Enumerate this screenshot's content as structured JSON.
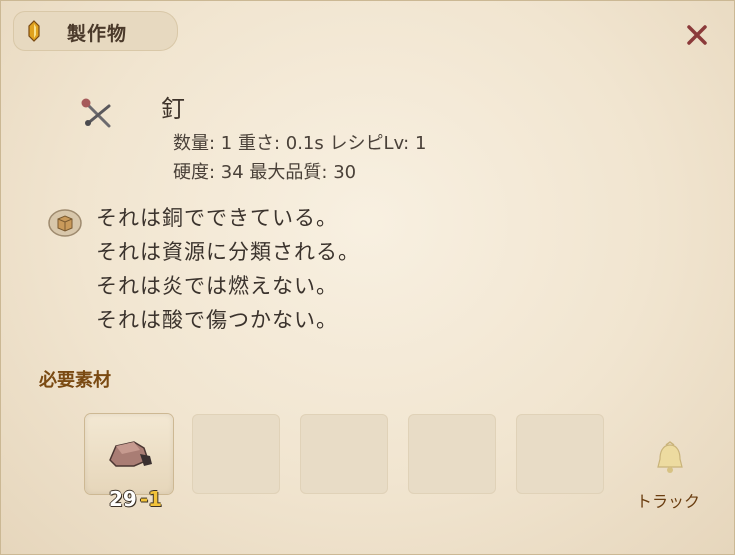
{
  "window": {
    "title": "製作物",
    "close_icon": "close-x-icon",
    "accent_color": "#7a4a12"
  },
  "item": {
    "name": "釘",
    "icon": "nail-icon",
    "stats_line1": [
      {
        "label": "数量",
        "value": "1"
      },
      {
        "label": "重さ",
        "value": "0.1s"
      },
      {
        "label": "レシピLv",
        "value": "1"
      }
    ],
    "stats_line2": [
      {
        "label": "硬度",
        "value": "34"
      },
      {
        "label": "最大品質",
        "value": "30"
      }
    ],
    "stats_text1": "数量: 1  重さ: 0.1s  レシピLv: 1",
    "stats_text2": "硬度: 34  最大品質: 30"
  },
  "description": {
    "icon": "material-box-icon",
    "lines": [
      "それは銅でできている。",
      "それは資源に分類される。",
      "それは炎では燃えない。",
      "それは酸で傷つかない。"
    ]
  },
  "materials": {
    "title": "必要素材",
    "slots": [
      {
        "filled": true,
        "icon": "copper-ore-icon",
        "count": "29",
        "consume": "-1"
      },
      {
        "filled": false
      },
      {
        "filled": false
      },
      {
        "filled": false
      },
      {
        "filled": false
      }
    ]
  },
  "track": {
    "icon": "bell-icon",
    "label": "トラック"
  }
}
